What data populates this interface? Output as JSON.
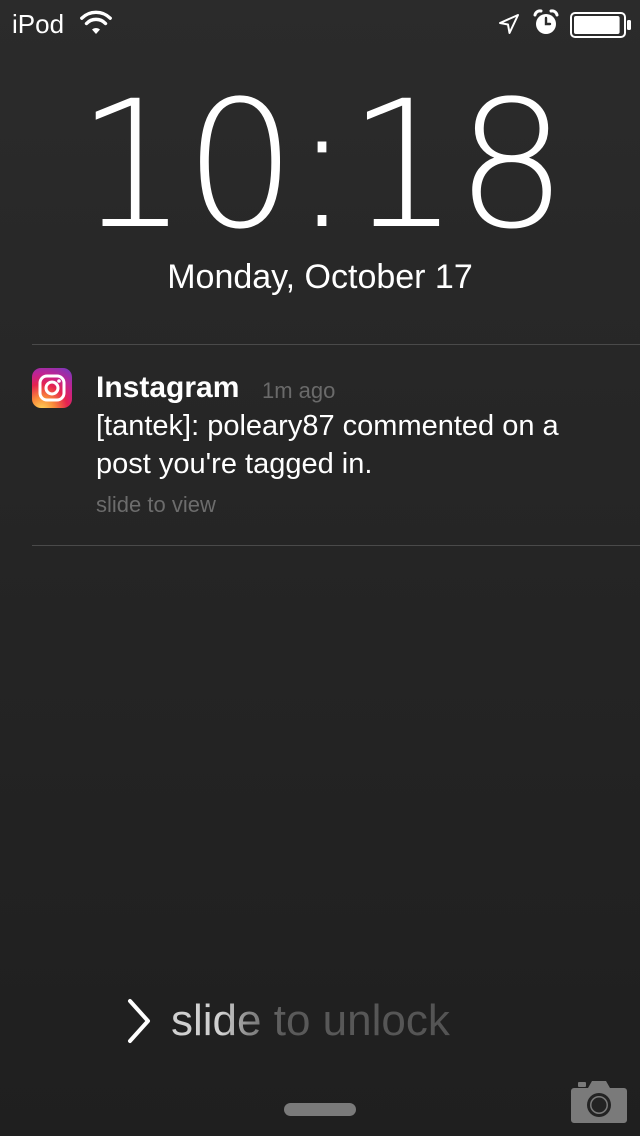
{
  "status_bar": {
    "carrier": "iPod",
    "icons": [
      "wifi-icon",
      "location-arrow-icon",
      "alarm-clock-icon",
      "battery-icon"
    ],
    "battery_level_percent": 95
  },
  "lock_screen": {
    "time": "10:18",
    "date": "Monday, October 17"
  },
  "notification": {
    "app_name": "Instagram",
    "app_icon": "instagram-icon",
    "time_ago": "1m ago",
    "message": "[tantek]: poleary87 commented on a post you're tagged in.",
    "action_hint": "slide to view"
  },
  "unlock": {
    "label": "slide to unlock",
    "chevron_icon": "chevron-right-icon"
  },
  "bottom": {
    "camera_icon": "camera-icon"
  },
  "colors": {
    "background": "#232323",
    "text_primary": "#ffffff",
    "text_secondary": "#6a6a6a",
    "divider": "#4a4a4a"
  }
}
